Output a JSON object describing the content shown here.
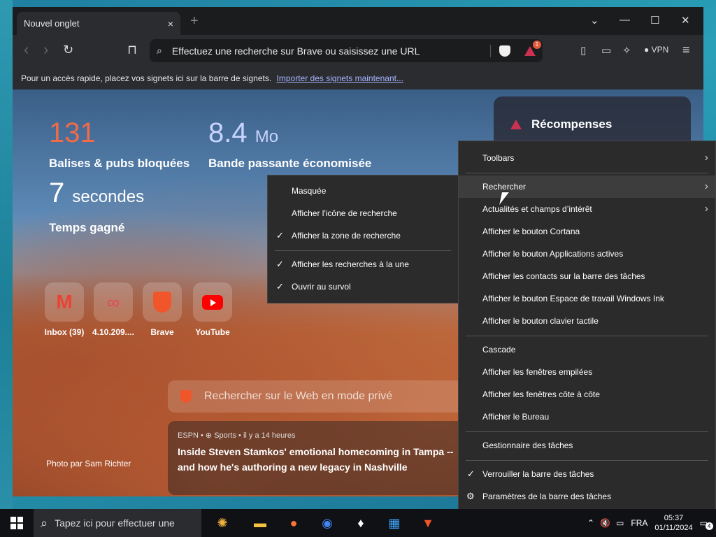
{
  "window": {
    "tab_title": "Nouvel onglet",
    "tab_close": "×",
    "new_tab": "+",
    "controls": [
      "⌄",
      "—",
      "☐",
      "✕"
    ]
  },
  "toolbar": {
    "back": "‹",
    "forward": "›",
    "reload": "↻",
    "bookmark": "⊓",
    "address_placeholder": "Effectuez une recherche sur Brave ou saisissez une URL",
    "rewards_badge": "1",
    "vpn": "VPN",
    "menu": "≡"
  },
  "bookmarks_bar": {
    "text": "Pour un accès rapide, placez vos signets ici sur la barre de signets.",
    "link": "Importer des signets maintenant..."
  },
  "stats": {
    "trackers_value": "131",
    "trackers_label": "Balises & pubs bloquées",
    "bandwidth_value": "8.4",
    "bandwidth_unit": "Mo",
    "bandwidth_label": "Bande passante économisée",
    "time_value": "7",
    "time_unit": "secondes",
    "time_label": "Temps gagné"
  },
  "tiles": [
    {
      "label": "Inbox (39)"
    },
    {
      "label": "4.10.209...."
    },
    {
      "label": "Brave"
    },
    {
      "label": "YouTube"
    }
  ],
  "private_search": "Rechercher sur le Web en mode privé",
  "news": {
    "meta": "ESPN • ⊕ Sports • il y a 14 heures",
    "title": "Inside Steven Stamkos' emotional homecoming in Tampa -- and how he's authoring a new legacy in Nashville"
  },
  "photo_credit": "Photo par Sam Richter",
  "rewards_title": "Récompenses",
  "search_submenu": {
    "items": [
      {
        "label": "Masquée",
        "checked": false
      },
      {
        "label": "Afficher l'icône de recherche",
        "checked": false
      },
      {
        "label": "Afficher la zone de recherche",
        "checked": true
      },
      {
        "label": "Afficher les recherches à la une",
        "checked": true
      },
      {
        "label": "Ouvrir au survol",
        "checked": true
      }
    ],
    "check_glyph": "✓"
  },
  "taskbar_menu": {
    "items": [
      {
        "label": "Toolbars",
        "arrow": "›"
      },
      {
        "label": "Rechercher",
        "arrow": "›"
      },
      {
        "label": "Actualités et champs d’intérêt",
        "arrow": "›"
      },
      {
        "label": "Afficher le bouton Cortana"
      },
      {
        "label": "Afficher le bouton Applications actives"
      },
      {
        "label": "Afficher les contacts sur la barre des tâches"
      },
      {
        "label": "Afficher le bouton Espace de travail Windows Ink"
      },
      {
        "label": "Afficher le bouton clavier tactile"
      },
      {
        "label": "Cascade"
      },
      {
        "label": "Afficher les fenêtres empilées"
      },
      {
        "label": "Afficher les fenêtres côte à côte"
      },
      {
        "label": "Afficher le Bureau"
      },
      {
        "label": "Gestionnaire des tâches"
      },
      {
        "label": "Verrouiller la barre des tâches",
        "check": "✓"
      },
      {
        "label": "Paramètres de la barre des tâches",
        "icon": "⚙"
      }
    ]
  },
  "taskbar": {
    "search_placeholder": "Tapez ici pour effectuer une",
    "lang": "FRA",
    "time": "05:37",
    "date": "01/11/2024",
    "notif_count": "4"
  }
}
